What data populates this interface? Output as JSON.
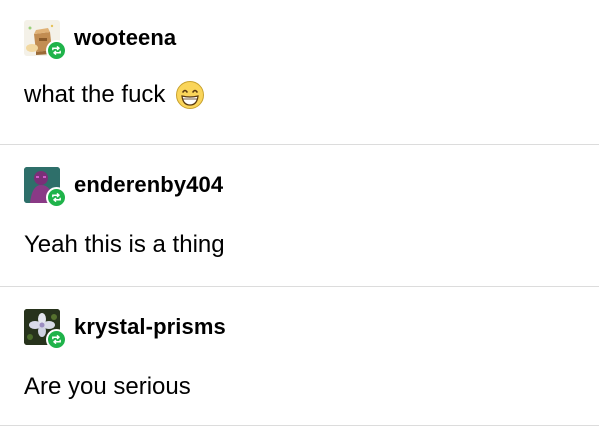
{
  "posts": [
    {
      "username": "wooteena",
      "text": "what the fuck",
      "avatar_icon": "cardboard-box-avatar",
      "emoji": "grinning-face-with-smiling-eyes-emoji"
    },
    {
      "username": "enderenby404",
      "text": "Yeah this is a thing",
      "avatar_icon": "purple-figure-avatar"
    },
    {
      "username": "krystal-prisms",
      "text": "Are you serious",
      "avatar_icon": "white-flower-avatar"
    }
  ],
  "colors": {
    "reblog_badge": "#1fb34a",
    "divider": "#dcdcdc",
    "text": "#000000"
  },
  "icons": {
    "reblog": "reblog-icon"
  }
}
